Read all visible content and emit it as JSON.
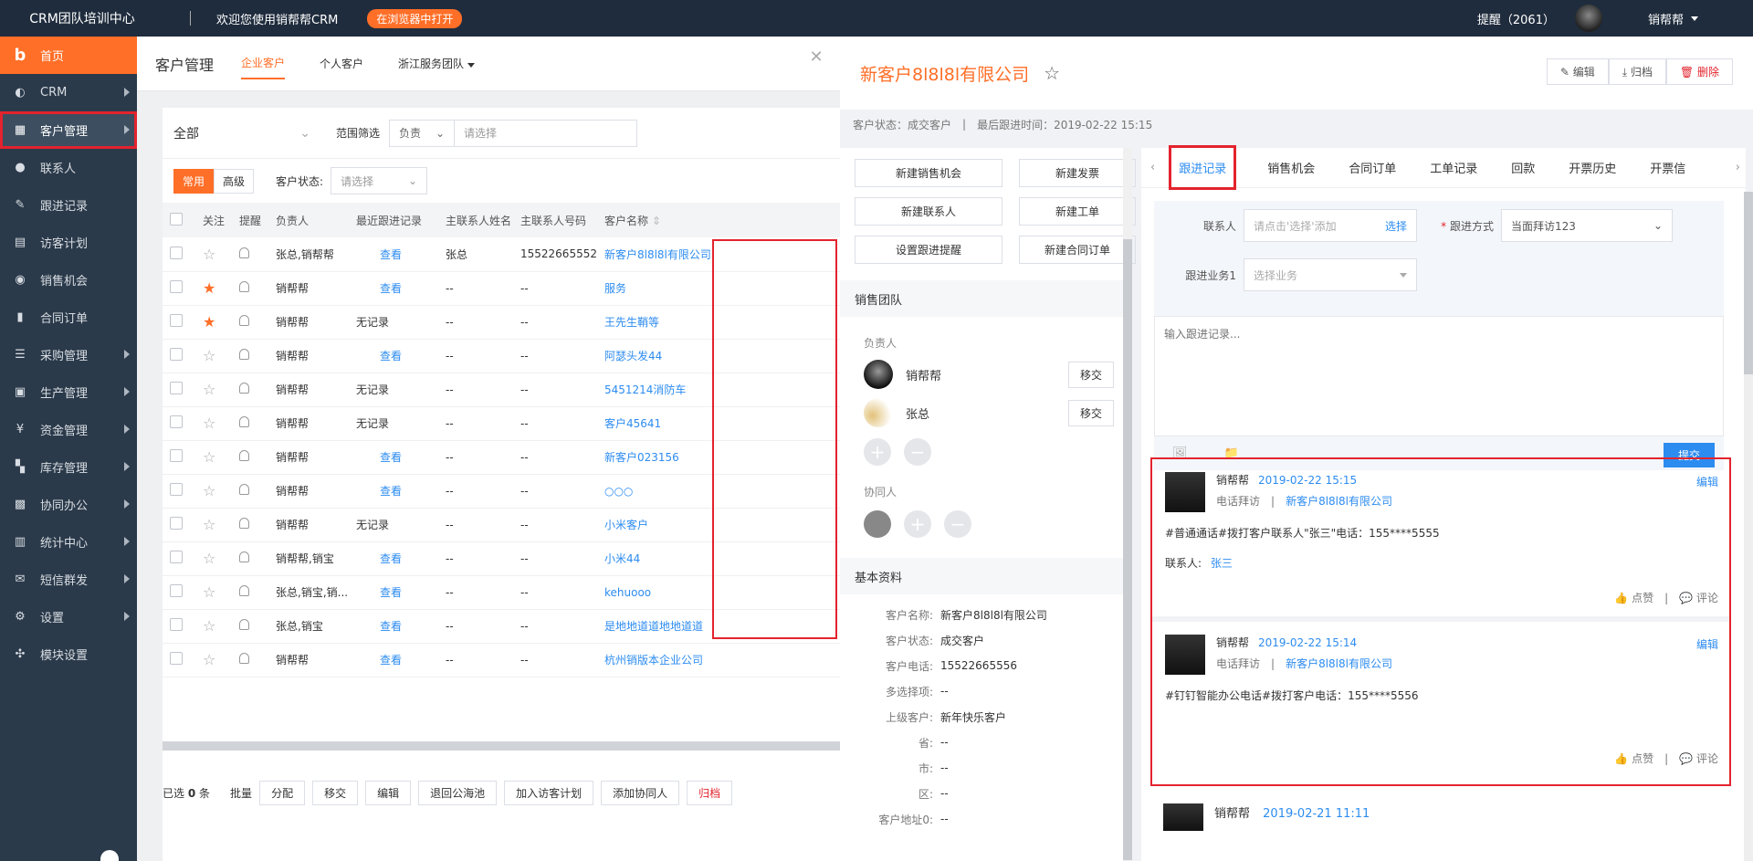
{
  "topbar": {
    "brand": "CRM团队培训中心",
    "welcome": "欢迎您使用销帮帮CRM",
    "open_browser": "在浏览器中打开",
    "remind": "提醒（2061）",
    "user": "销帮帮"
  },
  "sidebar": {
    "items": [
      {
        "label": "首页",
        "icon": "home-icon"
      },
      {
        "label": "CRM",
        "icon": "pie-icon"
      },
      {
        "label": "客户管理",
        "icon": "building-icon"
      },
      {
        "label": "联系人",
        "icon": "person-icon"
      },
      {
        "label": "跟进记录",
        "icon": "note-icon"
      },
      {
        "label": "访客计划",
        "icon": "calendar-icon"
      },
      {
        "label": "销售机会",
        "icon": "target-icon"
      },
      {
        "label": "合同订单",
        "icon": "document-icon"
      },
      {
        "label": "采购管理",
        "icon": "list-icon"
      },
      {
        "label": "生产管理",
        "icon": "clipboard-icon"
      },
      {
        "label": "资金管理",
        "icon": "money-icon"
      },
      {
        "label": "库存管理",
        "icon": "grid-icon"
      },
      {
        "label": "协同办公",
        "icon": "briefcase-icon"
      },
      {
        "label": "统计中心",
        "icon": "chart-icon"
      },
      {
        "label": "短信群发",
        "icon": "mail-icon"
      },
      {
        "label": "设置",
        "icon": "gear-icon"
      },
      {
        "label": "模块设置",
        "icon": "modules-icon"
      }
    ]
  },
  "main": {
    "title": "客户管理",
    "tabs": [
      "企业客户",
      "个人客户",
      "浙江服务团队"
    ],
    "filter_all": "全部",
    "range_label": "范围筛选",
    "range_select": "负责",
    "range_placeholder": "请选择",
    "seg_common": "常用",
    "seg_advanced": "高级",
    "status_label": "客户状态:",
    "status_placeholder": "请选择",
    "columns": [
      "关注",
      "提醒",
      "负责人",
      "最近跟进记录",
      "主联系人姓名",
      "主联系人号码",
      "客户名称"
    ],
    "rows": [
      {
        "star": false,
        "owner": "张总,销帮帮",
        "recent": "查看",
        "contact": "张总",
        "phone": "15522665552",
        "name": "新客户8l8l8l有限公司"
      },
      {
        "star": true,
        "owner": "销帮帮",
        "recent": "查看",
        "contact": "--",
        "phone": "--",
        "name": "服务"
      },
      {
        "star": true,
        "owner": "销帮帮",
        "recent": "无记录",
        "contact": "--",
        "phone": "--",
        "name": "王先生鞘等"
      },
      {
        "star": false,
        "owner": "销帮帮",
        "recent": "查看",
        "contact": "--",
        "phone": "--",
        "name": "阿瑟头发44"
      },
      {
        "star": false,
        "owner": "销帮帮",
        "recent": "无记录",
        "contact": "--",
        "phone": "--",
        "name": "5451214消防车"
      },
      {
        "star": false,
        "owner": "销帮帮",
        "recent": "无记录",
        "contact": "--",
        "phone": "--",
        "name": "客户45641"
      },
      {
        "star": false,
        "owner": "销帮帮",
        "recent": "查看",
        "contact": "--",
        "phone": "--",
        "name": "新客户023156"
      },
      {
        "star": false,
        "owner": "销帮帮",
        "recent": "查看",
        "contact": "--",
        "phone": "--",
        "name": "○○○"
      },
      {
        "star": false,
        "owner": "销帮帮",
        "recent": "无记录",
        "contact": "--",
        "phone": "--",
        "name": "小米客户"
      },
      {
        "star": false,
        "owner": "销帮帮,销宝",
        "recent": "查看",
        "contact": "--",
        "phone": "--",
        "name": "小米44"
      },
      {
        "star": false,
        "owner": "张总,销宝,销...",
        "recent": "查看",
        "contact": "--",
        "phone": "--",
        "name": "kehuooo"
      },
      {
        "star": false,
        "owner": "张总,销宝",
        "recent": "查看",
        "contact": "--",
        "phone": "--",
        "name": "是地地道道地地道道"
      },
      {
        "star": false,
        "owner": "销帮帮",
        "recent": "查看",
        "contact": "--",
        "phone": "--",
        "name": "杭州销版本企业公司"
      }
    ],
    "selected_prefix": "已选",
    "selected_count": "0",
    "selected_suffix": "条",
    "batch_label": "批量",
    "batch_buttons": [
      "分配",
      "移交",
      "编辑",
      "退回公海池",
      "加入访客计划",
      "添加协同人",
      "归档"
    ]
  },
  "drawer": {
    "title": "新客户8l8l8l有限公司",
    "actions": {
      "edit": "编辑",
      "archive": "归档",
      "delete": "删除"
    },
    "meta_status": "客户状态：成交客户",
    "meta_sep": "|",
    "meta_last": "最后跟进时间：2019-02-22 15:15",
    "quick_buttons": [
      "新建销售机会",
      "新建发票",
      "新建联系人",
      "新建工单",
      "设置跟进提醒",
      "新建合同订单"
    ],
    "sales_team": "销售团队",
    "owner_label": "负责人",
    "owners": [
      {
        "name": "销帮帮",
        "action": "移交"
      },
      {
        "name": "张总",
        "action": "移交"
      }
    ],
    "collab_label": "协同人",
    "basic_info": "基本资料",
    "info": [
      {
        "k": "客户名称:",
        "v": "新客户8l8l8l有限公司"
      },
      {
        "k": "客户状态:",
        "v": "成交客户"
      },
      {
        "k": "客户电话:",
        "v": "15522665556"
      },
      {
        "k": "多选择项:",
        "v": "--"
      },
      {
        "k": "上级客户:",
        "v": "新年快乐客户"
      },
      {
        "k": "省:",
        "v": "--"
      },
      {
        "k": "市:",
        "v": "--"
      },
      {
        "k": "区:",
        "v": "--"
      },
      {
        "k": "客户地址0:",
        "v": "--"
      }
    ],
    "tabs": [
      "跟进记录",
      "销售机会",
      "合同订单",
      "工单记录",
      "回款",
      "开票历史",
      "开票信"
    ],
    "form": {
      "contact_label": "联系人",
      "contact_placeholder": "请点击'选择'添加",
      "choose": "选择",
      "method_label": "跟进方式",
      "method_value": "当面拜访123",
      "biz_label": "跟进业务1",
      "biz_placeholder": "选择业务",
      "record_placeholder": "输入跟进记录...",
      "submit": "提交"
    },
    "posts": [
      {
        "who": "销帮帮",
        "date": "2019-02-22 15:15",
        "type": "电话拜访",
        "sep": "|",
        "company": "新客户8l8l8l有限公司",
        "edit": "编辑",
        "body": "#普通通话#拨打客户联系人\"张三\"电话：155****5555",
        "contact_label": "联系人:",
        "contact": "张三",
        "like": "点赞",
        "comment": "评论"
      },
      {
        "who": "销帮帮",
        "date": "2019-02-22 15:14",
        "type": "电话拜访",
        "sep": "|",
        "company": "新客户8l8l8l有限公司",
        "edit": "编辑",
        "body": "#钉钉智能办公电话#拨打客户电话：155****5556",
        "like": "点赞",
        "comment": "评论"
      }
    ],
    "post3": {
      "who": "销帮帮",
      "date": "2019-02-21 11:11"
    }
  }
}
